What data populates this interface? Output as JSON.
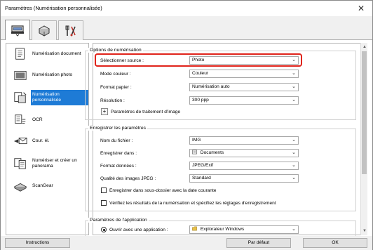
{
  "window": {
    "title": "Paramètres (Numérisation personnalisée)"
  },
  "tabs": [
    {
      "name": "scan-tab",
      "icon": "scanner-icon"
    },
    {
      "name": "device-tab",
      "icon": "scanner-device-icon"
    },
    {
      "name": "general-settings-tab",
      "icon": "tools-icon"
    }
  ],
  "sidebar": {
    "items": [
      {
        "label": "Numérisation document",
        "icon": "document-scan-icon"
      },
      {
        "label": "Numérisation photo",
        "icon": "photo-scan-icon"
      },
      {
        "label": "Numérisation personnalisée",
        "icon": "custom-scan-icon",
        "active": true
      },
      {
        "label": "OCR",
        "icon": "ocr-icon"
      },
      {
        "label": "Cour. él.",
        "icon": "email-icon"
      },
      {
        "label": "Numériser et créer un panorama",
        "icon": "panorama-icon"
      },
      {
        "label": "ScanGear",
        "icon": "scangear-icon"
      }
    ]
  },
  "scan_options": {
    "title": "Options de numérisation",
    "source": {
      "label": "Sélectionner source :",
      "value": "Photo"
    },
    "color_mode": {
      "label": "Mode couleur :",
      "value": "Couleur"
    },
    "paper_size": {
      "label": "Format papier :",
      "value": "Numérisation auto"
    },
    "resolution": {
      "label": "Résolution :",
      "value": "300 ppp"
    },
    "image_processing": {
      "label": "Paramètres de traitement d'image",
      "button": "+"
    }
  },
  "save_settings": {
    "title": "Enregistrer les paramètres",
    "file_name": {
      "label": "Nom du fichier :",
      "value": "IMG"
    },
    "save_in": {
      "label": "Enregistrer dans :",
      "value": "Documents"
    },
    "data_format": {
      "label": "Format données :",
      "value": "JPEG/Exif"
    },
    "jpeg_quality": {
      "label": "Qualité des images JPEG :",
      "value": "Standard"
    },
    "subfolder": {
      "label": "Enregistrer dans sous-dossier avec la date courante",
      "checked": false
    },
    "verify": {
      "label": "Vérifiez les résultats de la numérisation et spécifiez les réglages d'enregistrement",
      "checked": false
    }
  },
  "app_settings": {
    "title": "Paramètres de l'application",
    "open_with": {
      "label": "Ouvrir avec une application :",
      "value": "Explorateur Windows",
      "selected": true
    }
  },
  "footer": {
    "instructions": "Instructions",
    "defaults": "Par défaut",
    "ok": "OK"
  },
  "colors": {
    "highlight": "#e0241b",
    "selection": "#1e7bd6"
  }
}
